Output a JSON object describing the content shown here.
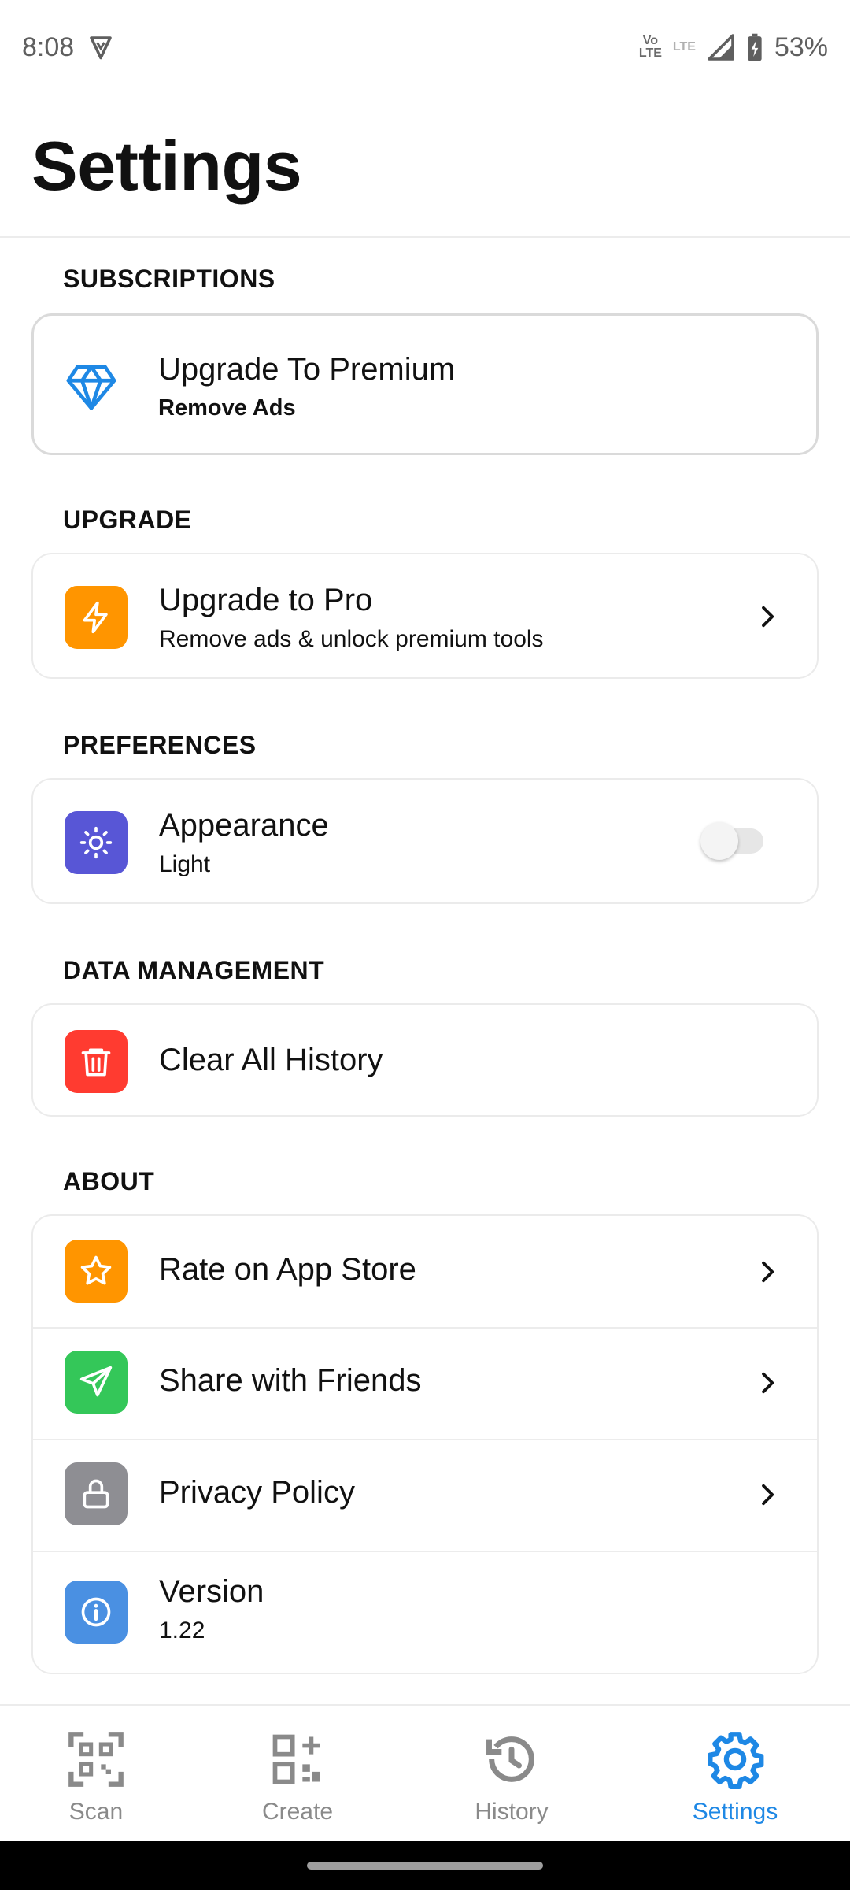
{
  "status_bar": {
    "time": "8:08",
    "volte_top": "Vo",
    "volte_bottom": "LTE",
    "lte_label": "LTE",
    "battery": "53%"
  },
  "header": {
    "title": "Settings"
  },
  "sections": {
    "subscriptions": {
      "title": "SUBSCRIPTIONS",
      "premium": {
        "title": "Upgrade To Premium",
        "subtitle": "Remove Ads",
        "icon": "diamond-icon"
      }
    },
    "upgrade": {
      "title": "UPGRADE",
      "pro": {
        "title": "Upgrade to Pro",
        "subtitle": "Remove ads & unlock premium tools",
        "icon": "lightning-icon",
        "color": "#FF9500"
      }
    },
    "preferences": {
      "title": "PREFERENCES",
      "appearance": {
        "title": "Appearance",
        "subtitle": "Light",
        "icon": "sun-icon",
        "color": "#5856D6",
        "toggle_on": false
      }
    },
    "data_management": {
      "title": "DATA MANAGEMENT",
      "clear": {
        "title": "Clear All History",
        "icon": "trash-icon",
        "color": "#FF3B30"
      }
    },
    "about": {
      "title": "ABOUT",
      "items": [
        {
          "title": "Rate on App Store",
          "icon": "star-icon",
          "color": "#FF9500"
        },
        {
          "title": "Share with Friends",
          "icon": "send-icon",
          "color": "#34C759"
        },
        {
          "title": "Privacy Policy",
          "icon": "lock-icon",
          "color": "#8E8E93"
        },
        {
          "title": "Version",
          "subtitle": "1.22",
          "icon": "info-icon",
          "color": "#4A90E2"
        }
      ]
    }
  },
  "bottom_nav": {
    "active_color": "#1E88E5",
    "items": [
      {
        "label": "Scan",
        "icon": "qr-scan-icon"
      },
      {
        "label": "Create",
        "icon": "qr-create-icon"
      },
      {
        "label": "History",
        "icon": "history-icon"
      },
      {
        "label": "Settings",
        "icon": "gear-icon",
        "active": true
      }
    ]
  }
}
